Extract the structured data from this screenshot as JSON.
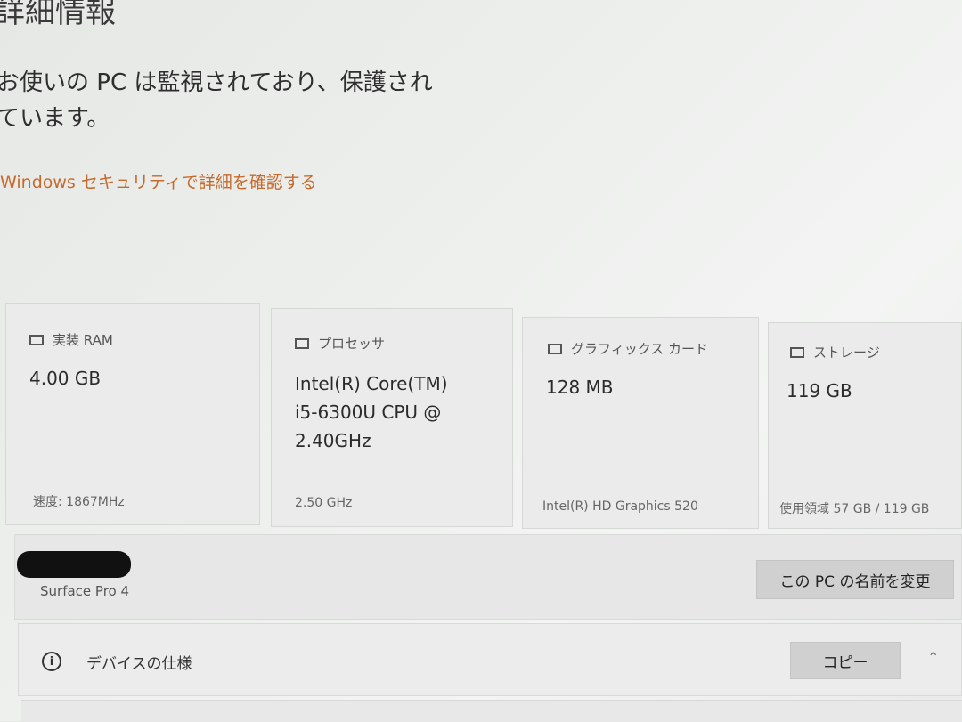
{
  "header": {
    "title": "詳細情報",
    "status_line1": "お使いの PC は監視されており、保護され",
    "status_line2": "ています。",
    "security_link": "Windows セキュリティで詳細を確認する"
  },
  "cards": [
    {
      "icon": "ram-icon",
      "label": "実装 RAM",
      "value": "4.00 GB",
      "footer": "速度: 1867MHz"
    },
    {
      "icon": "processor-icon",
      "label": "プロセッサ",
      "value_lines": [
        "Intel(R) Core(TM)",
        "i5-6300U CPU @",
        "2.40GHz"
      ],
      "footer": "2.50 GHz"
    },
    {
      "icon": "graphics-card-icon",
      "label": "グラフィックス カード",
      "value": "128 MB",
      "footer": "Intel(R) HD Graphics 520"
    },
    {
      "icon": "storage-icon",
      "label": "ストレージ",
      "value": "119 GB",
      "footer": "使用領域 57 GB / 119 GB"
    }
  ],
  "pc": {
    "model": "Surface Pro 4",
    "rename_button": "この PC の名前を変更"
  },
  "device_spec": {
    "label": "デバイスの仕様",
    "copy_button": "コピー",
    "info_icon": "info-icon",
    "chevron_icon": "chevron-up-icon"
  },
  "colors": {
    "link": "#c56a2c",
    "background": "#eceeec"
  }
}
